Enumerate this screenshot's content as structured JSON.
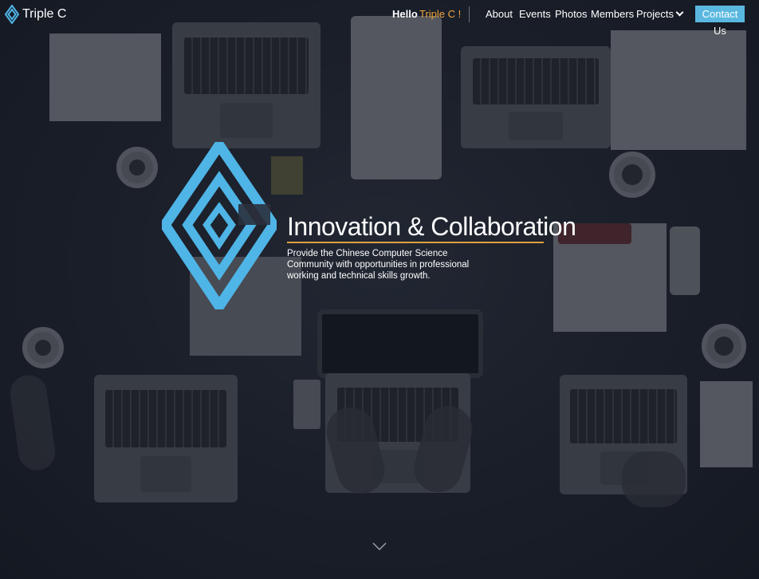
{
  "nav": {
    "brand_name": "Triple C",
    "greeting": "Hello",
    "greeting_name": "Triple C !",
    "menu": [
      "About",
      "Events",
      "Photos",
      "Members",
      "Projects"
    ],
    "contact_label": "Contact Us"
  },
  "hero": {
    "title": "Innovation & Collaboration",
    "description": "Provide the Chinese Computer Science Community with opportunities in professional working and technical skills growth."
  },
  "icons": {
    "brand_logo": "diamond-c-logo-icon",
    "projects_dropdown": "chevron-down-icon",
    "scroll": "chevron-down-icon"
  },
  "colors": {
    "accent_blue": "#5ab8e0",
    "logo_blue": "#4fb4e6",
    "accent_orange": "#f0a640",
    "overlay": "#1d2330"
  }
}
